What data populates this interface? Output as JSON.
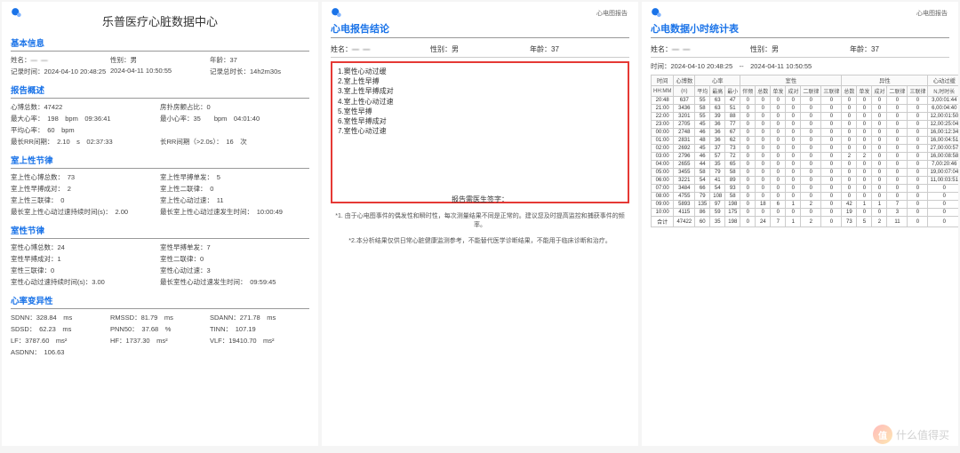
{
  "logo_icon": "lepu-logo-icon",
  "page1": {
    "title": "乐普医疗心脏数据中心",
    "sec_basic": "基本信息",
    "name_label": "姓名：",
    "name_value": "— —",
    "sex_label": "性别：男",
    "age_label": "年龄：37",
    "rec_start_label": "记录时间：",
    "rec_start": "2024-04-10 20:48:25",
    "rec_end": "2024-04-11 10:50:55",
    "dur_label": "记录总时长：",
    "dur": "14h2m30s",
    "sec_overview": "报告概述",
    "hb_total_label": "心博总数：",
    "hb_total": "47422",
    "atrial_pct_label": "房扑房颤占比：0",
    "max_hr": "最大心率：　198　bpm　09:36:41",
    "min_hr": "最小心率：35　　bpm　04:01:40",
    "avg_hr": "平均心率：　60　bpm",
    "max_rr": "最长RR间期：　2.10　s　02:37:33",
    "long_rr": "长RR间期（>2.0s）：　16　次",
    "sec_sv": "室上性节律",
    "sv1a": "室上性心博总数：　73",
    "sv1b": "室上性早搏单发：　5",
    "sv2a": "室上性早搏成对：　2",
    "sv2b": "室上性二联律：　0",
    "sv3a": "室上性三联律：　0",
    "sv3b": "室上性心动过速：　11",
    "sv4a": "最长室上性心动过速持续时间(s)：　2.00",
    "sv4b": "最长室上性心动过速发生时间：　10:00:49",
    "sec_v": "室性节律",
    "v1a": "室性心博总数：24",
    "v1b": "室性早搏单发：7",
    "v2a": "室性早搏成对：1",
    "v2b": "室性二联律：0",
    "v3a": "室性三联律：0",
    "v3b": "室性心动过速：3",
    "v4a": "室性心动过速持续时间(s)：3.00",
    "v4b": "最长室性心动过速发生时间：　09:59:45",
    "sec_hrv": "心率变异性",
    "hrv1a": "SDNN：328.84　ms",
    "hrv1b": "RMSSD：81.79　ms",
    "hrv1c": "SDANN：271.78　ms",
    "hrv2a": "SDSD：　62.23　ms",
    "hrv2b": "PNN50：　37.68　%",
    "hrv2c": "TINN：　107.19",
    "hrv3a": "LF：3787.60　ms²",
    "hrv3b": "HF：1737.30　ms²",
    "hrv3c": "VLF：19410.70　ms²",
    "hrv4a": "ASDNN：　106.63"
  },
  "page2": {
    "top_right": "心电图报告",
    "title": "心电报告结论",
    "name_label": "姓名：",
    "name_value": "— —",
    "sex": "性别：男",
    "age": "年龄：37",
    "items": [
      "1.窦性心动过缓",
      "2.室上性早搏",
      "3.室上性早搏成对",
      "4.室上性心动过速",
      "5.室性早搏",
      "6.室性早搏成对",
      "7.室性心动过速"
    ],
    "sig": "报告需医生签字：",
    "note1": "*1. 由于心电图事件的偶发性和瞬时性，每次测量结果不同是正常的。建议您及时提高监控和捕获事件的频率。",
    "note2": "*2.本分析结果仅供日常心脏健康监测参考，不能替代医学诊断结果，不能用于临床诊断和治疗。"
  },
  "page3": {
    "top_right": "心电图报告",
    "title": "心电数据小时统计表",
    "name_label": "姓名：",
    "name_value": "— —",
    "sex": "性别：男",
    "age": "年龄：37",
    "time_row": "时间：2024-04-10 20:48:25　--　2024-04-11 10:50:55",
    "group_headers": [
      "时间",
      "心博数",
      "心率",
      "",
      "",
      "室性",
      "",
      "",
      "",
      "",
      "",
      "异性",
      "",
      "",
      "",
      "",
      "心动过缓"
    ],
    "sub_headers": [
      "HH:MM",
      "(n)",
      "平均",
      "最高",
      "最小",
      "伴频",
      "总数",
      "单发",
      "成对",
      "二联律",
      "三联律",
      "总数",
      "单发",
      "成对",
      "二联律",
      "三联律",
      "N,时时长"
    ],
    "rows": [
      [
        "20:48",
        "637",
        "55",
        "63",
        "47",
        "0",
        "0",
        "0",
        "0",
        "0",
        "0",
        "0",
        "0",
        "0",
        "0",
        "0",
        "3,00:01:44"
      ],
      [
        "21:00",
        "3436",
        "58",
        "63",
        "51",
        "0",
        "0",
        "0",
        "0",
        "0",
        "0",
        "0",
        "0",
        "0",
        "0",
        "0",
        "6,00:04:40"
      ],
      [
        "22:00",
        "3201",
        "55",
        "39",
        "88",
        "0",
        "0",
        "0",
        "0",
        "0",
        "0",
        "0",
        "0",
        "0",
        "0",
        "0",
        "12,00:01:50"
      ],
      [
        "23:00",
        "2705",
        "45",
        "36",
        "77",
        "0",
        "0",
        "0",
        "0",
        "0",
        "0",
        "0",
        "0",
        "0",
        "0",
        "0",
        "12,00:25:04"
      ],
      [
        "00:00",
        "2748",
        "46",
        "36",
        "67",
        "0",
        "0",
        "0",
        "0",
        "0",
        "0",
        "0",
        "0",
        "0",
        "0",
        "0",
        "16,00:12:34"
      ],
      [
        "01:00",
        "2831",
        "48",
        "36",
        "62",
        "0",
        "0",
        "0",
        "0",
        "0",
        "0",
        "0",
        "0",
        "0",
        "0",
        "0",
        "16,00:04:51"
      ],
      [
        "02:00",
        "2692",
        "45",
        "37",
        "73",
        "0",
        "0",
        "0",
        "0",
        "0",
        "0",
        "0",
        "0",
        "0",
        "0",
        "0",
        "27,00:00:57"
      ],
      [
        "03:00",
        "2796",
        "46",
        "57",
        "72",
        "0",
        "0",
        "0",
        "0",
        "0",
        "0",
        "2",
        "2",
        "0",
        "0",
        "0",
        "16,00:08:58"
      ],
      [
        "04:00",
        "2655",
        "44",
        "35",
        "65",
        "0",
        "0",
        "0",
        "0",
        "0",
        "0",
        "0",
        "0",
        "0",
        "0",
        "0",
        "7,00:20:46"
      ],
      [
        "05:00",
        "3455",
        "58",
        "79",
        "58",
        "0",
        "0",
        "0",
        "0",
        "0",
        "0",
        "0",
        "0",
        "0",
        "0",
        "0",
        "19,00:07:04"
      ],
      [
        "06:00",
        "3221",
        "54",
        "41",
        "89",
        "0",
        "0",
        "0",
        "0",
        "0",
        "0",
        "0",
        "0",
        "0",
        "0",
        "0",
        "11,00:03:51"
      ],
      [
        "07:00",
        "3484",
        "66",
        "54",
        "93",
        "0",
        "0",
        "0",
        "0",
        "0",
        "0",
        "0",
        "0",
        "0",
        "0",
        "0",
        "0"
      ],
      [
        "08:00",
        "4755",
        "79",
        "108",
        "58",
        "0",
        "0",
        "0",
        "0",
        "0",
        "0",
        "0",
        "0",
        "0",
        "0",
        "0",
        "0"
      ],
      [
        "09:00",
        "5893",
        "135",
        "97",
        "198",
        "0",
        "18",
        "6",
        "1",
        "2",
        "0",
        "42",
        "1",
        "1",
        "7",
        "0",
        "0"
      ],
      [
        "10:00",
        "4115",
        "86",
        "59",
        "175",
        "0",
        "0",
        "0",
        "0",
        "0",
        "0",
        "19",
        "0",
        "0",
        "3",
        "0",
        "0"
      ],
      [
        "合计",
        "47422",
        "60",
        "35",
        "198",
        "0",
        "24",
        "7",
        "1",
        "2",
        "0",
        "73",
        "5",
        "2",
        "11",
        "0",
        "0"
      ]
    ]
  },
  "watermark": {
    "logo_text": "值",
    "text": "什么值得买"
  }
}
